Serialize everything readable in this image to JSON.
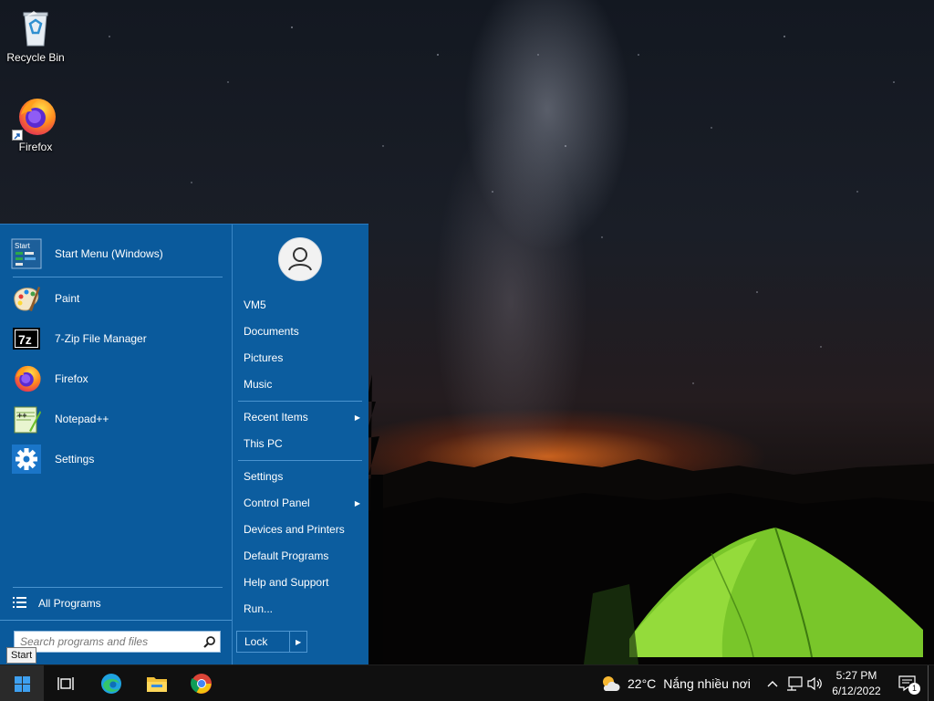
{
  "desktop": {
    "icons": [
      {
        "label": "Recycle Bin",
        "icon": "recycle-bin-icon"
      },
      {
        "label": "Firefox",
        "icon": "firefox-icon"
      }
    ]
  },
  "start_menu": {
    "pinned": [
      {
        "label": "Start Menu (Windows)",
        "icon": "start-menu-settings-icon"
      },
      {
        "label": "Paint",
        "icon": "paint-palette-icon"
      },
      {
        "label": "7-Zip File Manager",
        "icon": "7zip-icon"
      },
      {
        "label": "Firefox",
        "icon": "firefox-icon"
      },
      {
        "label": "Notepad++",
        "icon": "notepad-plus-plus-icon"
      },
      {
        "label": "Settings",
        "icon": "gear-icon"
      }
    ],
    "all_programs": "All Programs",
    "search_placeholder": "Search programs and files",
    "right": {
      "user": "VM5",
      "items": [
        {
          "label": "Documents",
          "has_submenu": false
        },
        {
          "label": "Pictures",
          "has_submenu": false
        },
        {
          "label": "Music",
          "has_submenu": false
        },
        {
          "label": "Recent Items",
          "has_submenu": true
        },
        {
          "label": "This PC",
          "has_submenu": false
        },
        {
          "label": "Settings",
          "has_submenu": false
        },
        {
          "label": "Control Panel",
          "has_submenu": true
        },
        {
          "label": "Devices and Printers",
          "has_submenu": false
        },
        {
          "label": "Default Programs",
          "has_submenu": false
        },
        {
          "label": "Help and Support",
          "has_submenu": false
        },
        {
          "label": "Run...",
          "has_submenu": false
        }
      ],
      "lock_label": "Lock"
    },
    "tooltip": "Start",
    "colors": {
      "background": "#0a5a9c",
      "separator": "#4a93cf"
    }
  },
  "taskbar": {
    "apps": [
      "task-view-icon",
      "edge-icon",
      "file-explorer-icon",
      "chrome-icon"
    ],
    "weather": {
      "temp": "22°C",
      "condition": "Nắng nhiều nơi",
      "icon": "partly-sunny-icon"
    },
    "clock": {
      "time": "5:27 PM",
      "date": "6/12/2022"
    },
    "notification_count": "1"
  }
}
